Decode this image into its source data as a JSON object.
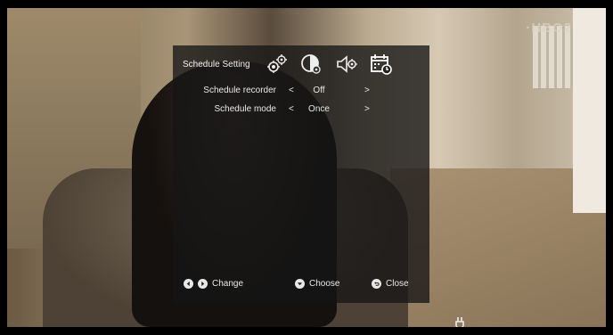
{
  "background": {
    "channel_logo": "·HBO2",
    "plug_icon": "plug-icon"
  },
  "osd": {
    "title": "Schedule Setting",
    "tabs": [
      {
        "icon": "gears-icon"
      },
      {
        "icon": "contrast-settings-icon"
      },
      {
        "icon": "speaker-settings-icon"
      },
      {
        "icon": "calendar-clock-icon"
      }
    ],
    "rows": [
      {
        "label": "Schedule recorder",
        "left": "<",
        "value": "Off",
        "right": ">"
      },
      {
        "label": "Schedule mode",
        "left": "<",
        "value": "Once",
        "right": ">"
      }
    ],
    "footer": {
      "change": "Change",
      "choose": "Choose",
      "close": "Close"
    }
  },
  "colors": {
    "panel": "#161616",
    "text": "#e8e8e8"
  }
}
